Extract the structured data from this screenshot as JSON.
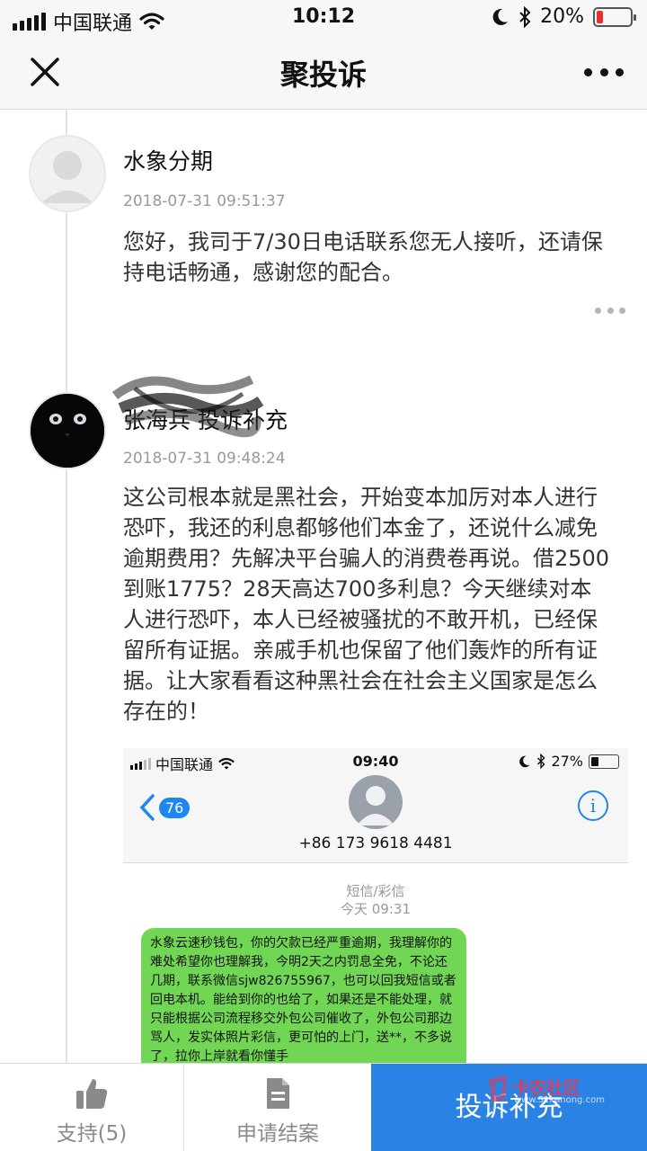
{
  "status_bar": {
    "carrier": "中国联通",
    "time": "10:12",
    "battery_text": "20%",
    "battery_level": 0.2
  },
  "nav": {
    "title": "聚投诉"
  },
  "entries": [
    {
      "name": "水象分期",
      "timestamp": "2018-07-31 09:51:37",
      "text": "您好，我司于7/30日电话联系您无人接听，还请保持电话畅通，感谢您的配合。"
    },
    {
      "name": "张海兵 投诉补充",
      "timestamp": "2018-07-31 09:48:24",
      "text": "这公司根本就是黑社会，开始变本加厉对本人进行恐吓，我还的利息都够他们本金了，还说什么减免逾期费用？先解决平台骗人的消费卷再说。借2500到账1775？28天高达700多利息？今天继续对本人进行恐吓，本人已经被骚扰的不敢开机，已经保留所有证据。亲戚手机也保留了他们轰炸的所有证据。让大家看看这种黑社会在社会主义国家是怎么存在的！"
    }
  ],
  "screenshot": {
    "carrier": "中国联通",
    "time": "09:40",
    "battery_text": "27%",
    "battery_level": 0.27,
    "back_badge": "76",
    "phone": "+86 173 9618 4481",
    "info": "i",
    "message_kind": "短信/彩信",
    "message_time": "今天 09:31",
    "message_text": "水象云速秒钱包，你的欠款已经严重逾期，我理解你的难处希望你也理解我，今明2天之内罚息全免，不论还几期，联系微信sjw826755967，也可以回我短信或者回电本机。能给到你的也给了，如果还是不能处理，就只能根据公司流程移交外包公司催收了，外包公司那边骂人，发实体照片彩信，更可怕的上门，送**，不多说了，拉你上岸就看你懂手"
  },
  "bottom_bar": {
    "support_label": "支持(5)",
    "close_label": "申请结案",
    "primary_label": "投诉补充",
    "primary_color": "#2a82e4"
  },
  "watermark": {
    "text": "卡农社区",
    "sub": "www.51kanong.com"
  }
}
